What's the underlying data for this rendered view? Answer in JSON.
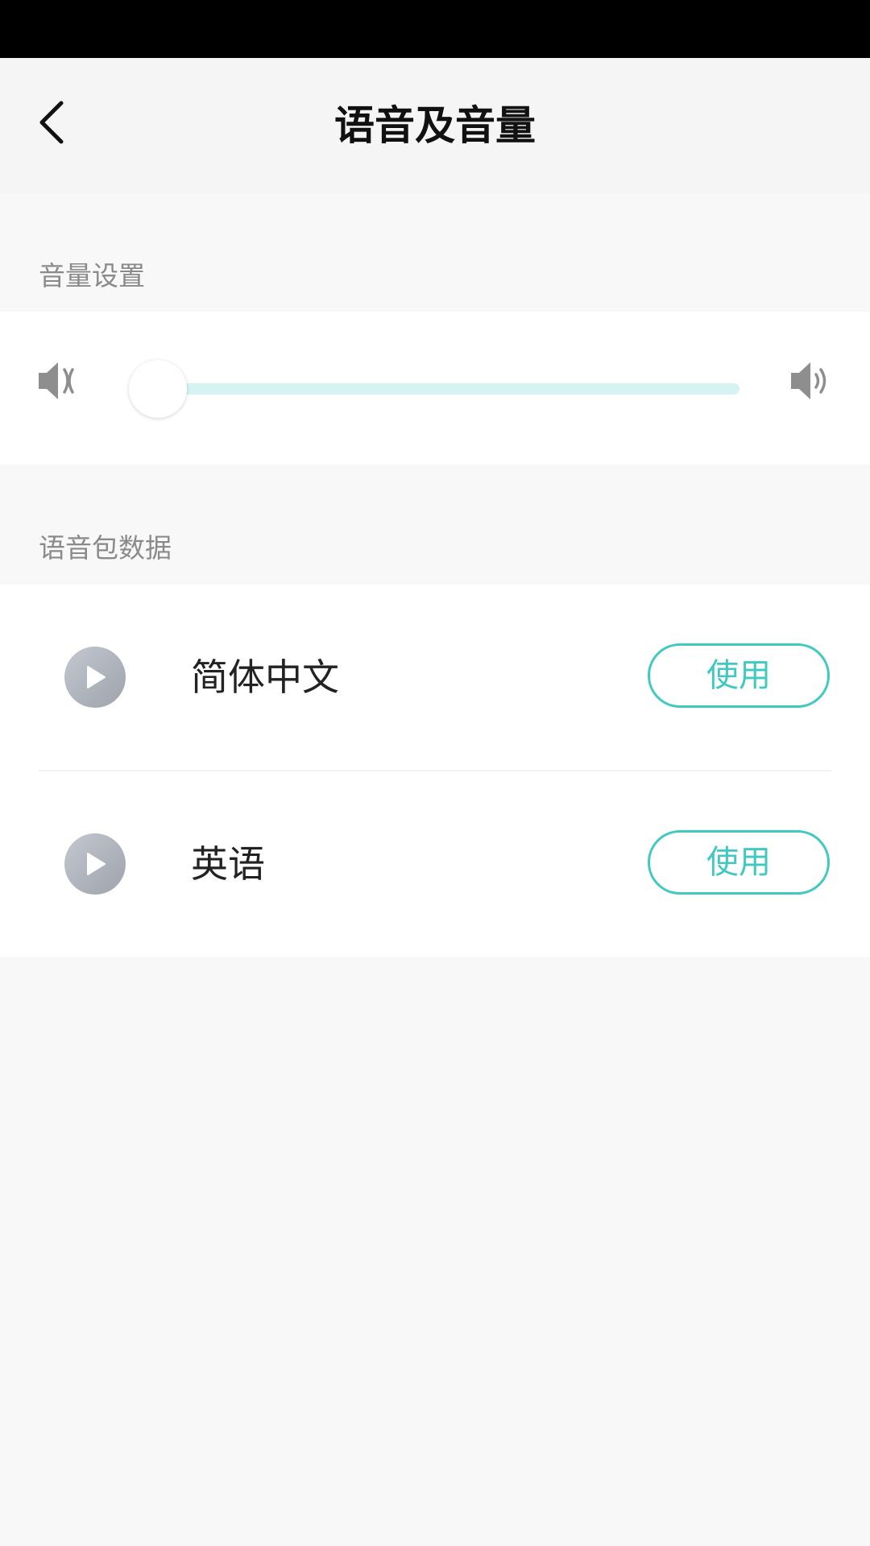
{
  "header": {
    "title": "语音及音量",
    "back_icon": "chevron-left-icon"
  },
  "volume_section": {
    "label": "音量设置",
    "volume_level": 0,
    "min_icon": "speaker-mute-icon",
    "max_icon": "speaker-loud-icon"
  },
  "voice_section": {
    "label": "语音包数据",
    "items": [
      {
        "name": "简体中文",
        "action_label": "使用"
      },
      {
        "name": "英语",
        "action_label": "使用"
      }
    ]
  },
  "colors": {
    "accent": "#3fc9c0",
    "track": "#d6f3f2",
    "background": "#f8f8f8",
    "status_bar": "#000000"
  }
}
